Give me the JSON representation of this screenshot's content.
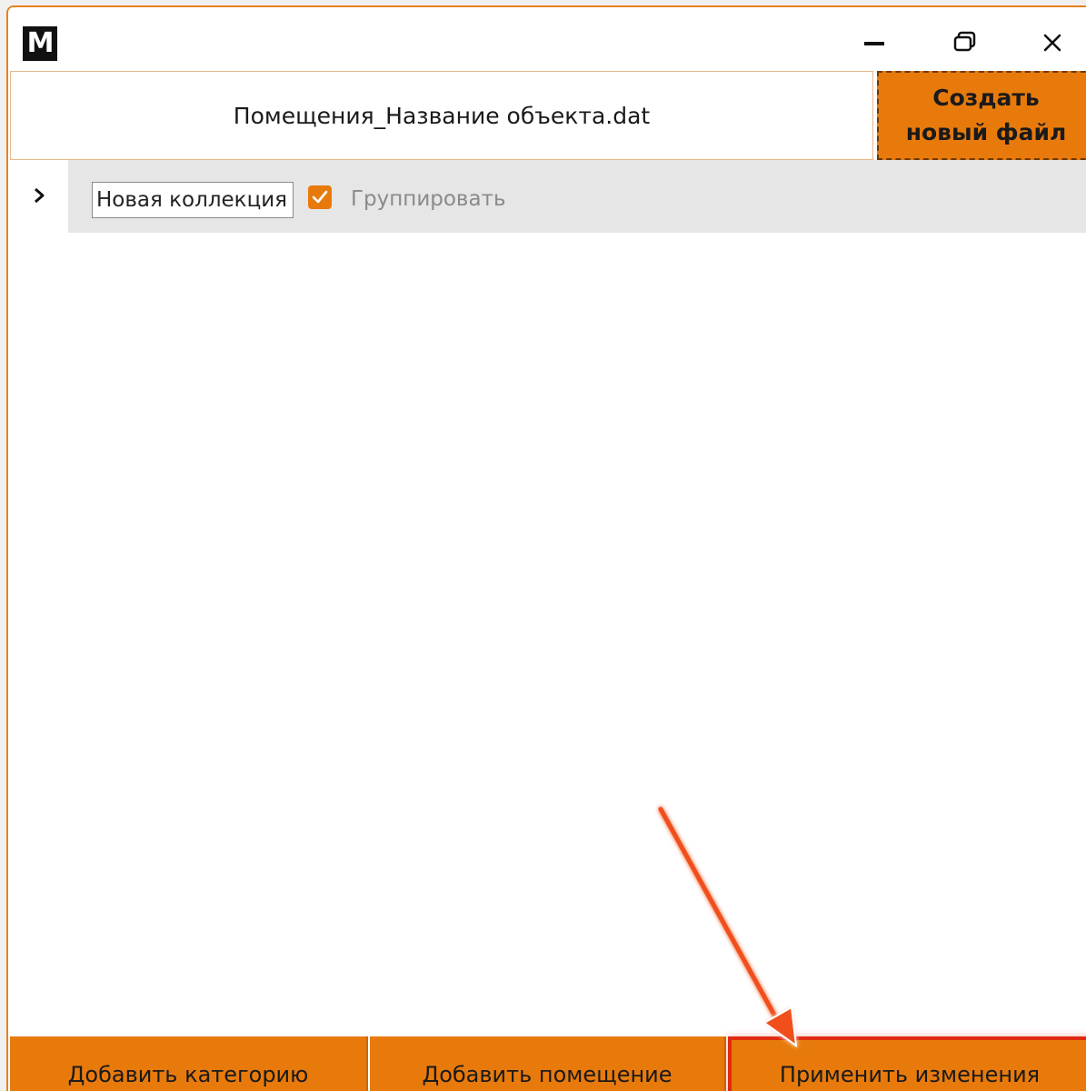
{
  "window": {
    "app_logo": "M",
    "icons": {
      "minimize": "minimize-icon",
      "maximize": "restore-icon",
      "close": "close-icon"
    }
  },
  "file": {
    "name": "Помещения_Название объекта.dat"
  },
  "create_button": {
    "label": "Создать\nновый файл"
  },
  "collection": {
    "expander_icon": "chevron-right-icon",
    "name_value": "Новая коллекция",
    "group_checked": true,
    "group_label": "Группировать"
  },
  "bottom_bar": {
    "add_category": "Добавить категорию",
    "add_room": "Добавить помещение",
    "apply_changes": "Применить изменения"
  },
  "colors": {
    "accent": "#e87a0c",
    "annotation": "#e02a10"
  }
}
